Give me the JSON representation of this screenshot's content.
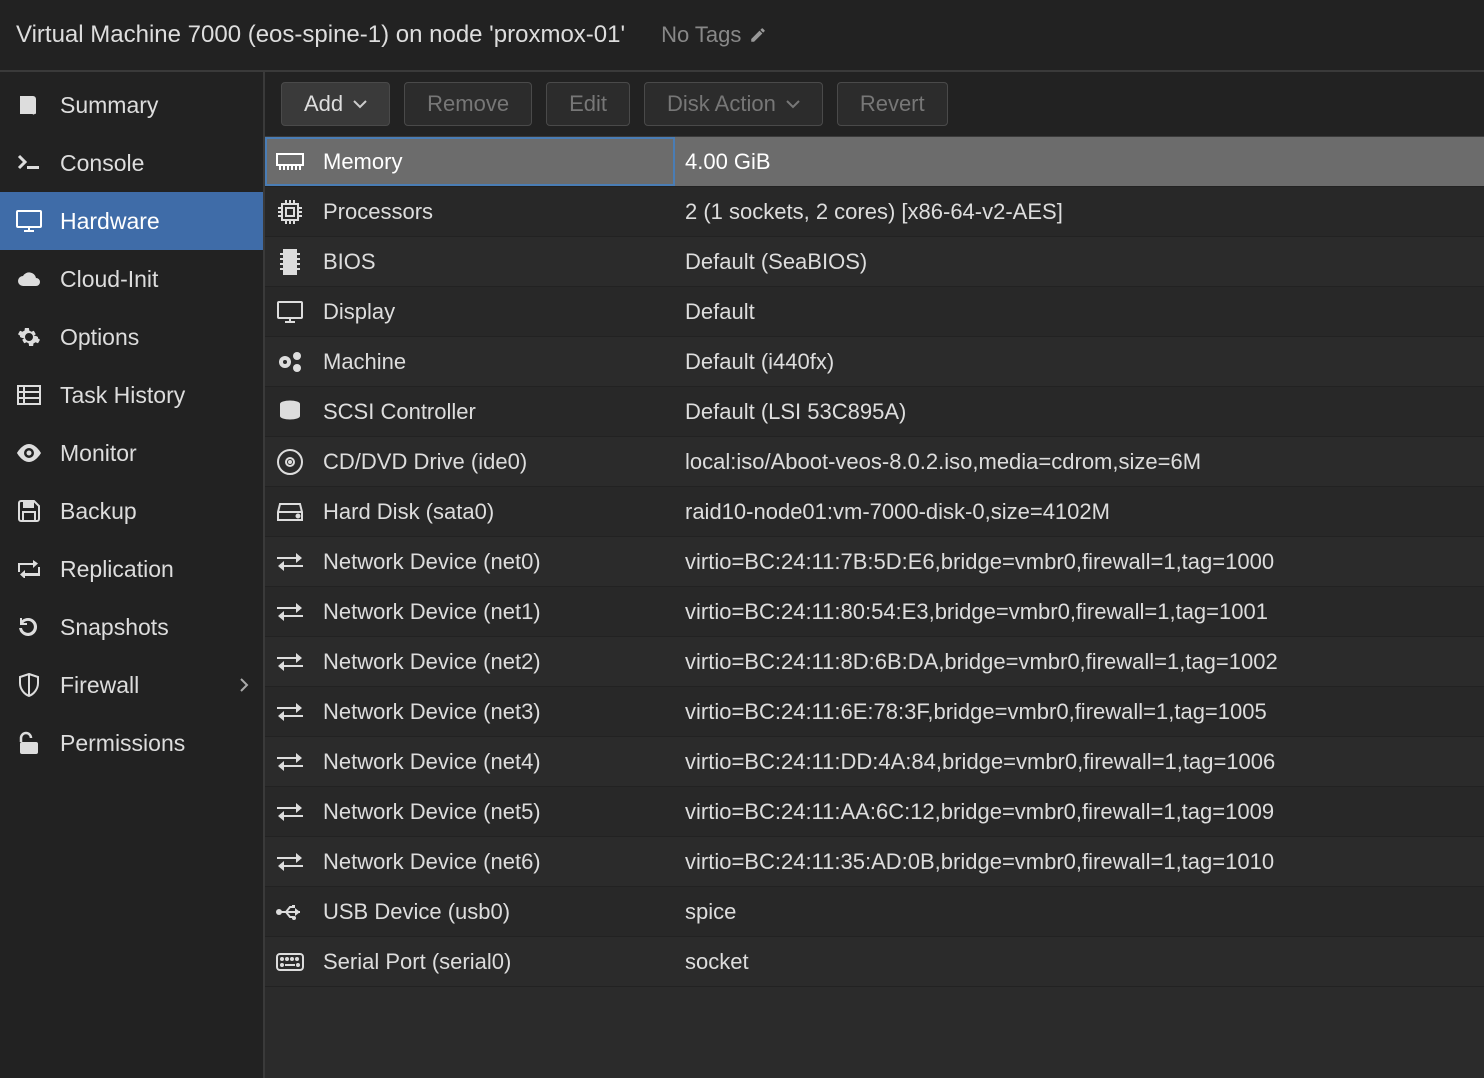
{
  "header": {
    "title": "Virtual Machine 7000 (eos-spine-1) on node 'proxmox-01'",
    "tags_label": "No Tags"
  },
  "sidebar": {
    "items": [
      {
        "label": "Summary",
        "icon": "book",
        "active": false
      },
      {
        "label": "Console",
        "icon": "terminal",
        "active": false
      },
      {
        "label": "Hardware",
        "icon": "desktop",
        "active": true
      },
      {
        "label": "Cloud-Init",
        "icon": "cloud",
        "active": false
      },
      {
        "label": "Options",
        "icon": "gear",
        "active": false
      },
      {
        "label": "Task History",
        "icon": "list",
        "active": false
      },
      {
        "label": "Monitor",
        "icon": "eye",
        "active": false
      },
      {
        "label": "Backup",
        "icon": "save",
        "active": false
      },
      {
        "label": "Replication",
        "icon": "retweet",
        "active": false
      },
      {
        "label": "Snapshots",
        "icon": "history",
        "active": false
      },
      {
        "label": "Firewall",
        "icon": "shield",
        "active": false,
        "expandable": true
      },
      {
        "label": "Permissions",
        "icon": "unlock",
        "active": false
      }
    ]
  },
  "toolbar": {
    "add_label": "Add",
    "remove_label": "Remove",
    "edit_label": "Edit",
    "disk_action_label": "Disk Action",
    "revert_label": "Revert"
  },
  "hardware": {
    "rows": [
      {
        "icon": "memory",
        "key": "Memory",
        "value": "4.00 GiB",
        "selected": true
      },
      {
        "icon": "cpu",
        "key": "Processors",
        "value": "2 (1 sockets, 2 cores) [x86-64-v2-AES]"
      },
      {
        "icon": "chip",
        "key": "BIOS",
        "value": "Default (SeaBIOS)"
      },
      {
        "icon": "desktop",
        "key": "Display",
        "value": "Default"
      },
      {
        "icon": "cogs",
        "key": "Machine",
        "value": "Default (i440fx)"
      },
      {
        "icon": "database",
        "key": "SCSI Controller",
        "value": "Default (LSI 53C895A)"
      },
      {
        "icon": "disc",
        "key": "CD/DVD Drive (ide0)",
        "value": "local:iso/Aboot-veos-8.0.2.iso,media=cdrom,size=6M"
      },
      {
        "icon": "hdd",
        "key": "Hard Disk (sata0)",
        "value": "raid10-node01:vm-7000-disk-0,size=4102M"
      },
      {
        "icon": "exchange",
        "key": "Network Device (net0)",
        "value": "virtio=BC:24:11:7B:5D:E6,bridge=vmbr0,firewall=1,tag=1000"
      },
      {
        "icon": "exchange",
        "key": "Network Device (net1)",
        "value": "virtio=BC:24:11:80:54:E3,bridge=vmbr0,firewall=1,tag=1001"
      },
      {
        "icon": "exchange",
        "key": "Network Device (net2)",
        "value": "virtio=BC:24:11:8D:6B:DA,bridge=vmbr0,firewall=1,tag=1002"
      },
      {
        "icon": "exchange",
        "key": "Network Device (net3)",
        "value": "virtio=BC:24:11:6E:78:3F,bridge=vmbr0,firewall=1,tag=1005"
      },
      {
        "icon": "exchange",
        "key": "Network Device (net4)",
        "value": "virtio=BC:24:11:DD:4A:84,bridge=vmbr0,firewall=1,tag=1006"
      },
      {
        "icon": "exchange",
        "key": "Network Device (net5)",
        "value": "virtio=BC:24:11:AA:6C:12,bridge=vmbr0,firewall=1,tag=1009"
      },
      {
        "icon": "exchange",
        "key": "Network Device (net6)",
        "value": "virtio=BC:24:11:35:AD:0B,bridge=vmbr0,firewall=1,tag=1010"
      },
      {
        "icon": "usb",
        "key": "USB Device (usb0)",
        "value": "spice"
      },
      {
        "icon": "keyboard",
        "key": "Serial Port (serial0)",
        "value": "socket"
      }
    ]
  }
}
